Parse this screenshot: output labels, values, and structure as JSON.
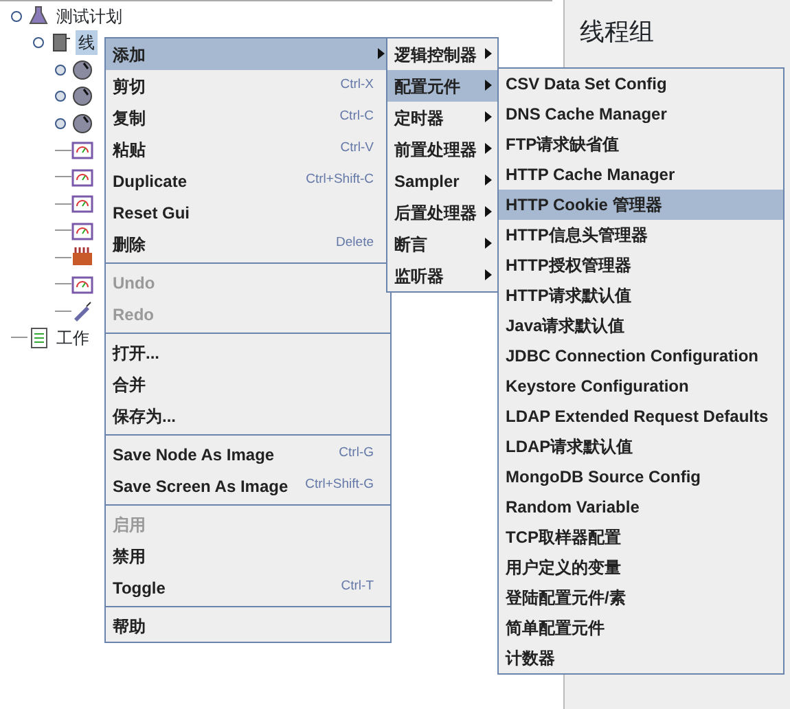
{
  "tree": {
    "label": "测试计划",
    "expanded": true,
    "children": [
      {
        "label": "线",
        "kind": "thread",
        "selected": true,
        "expanded": true,
        "children": [
          {
            "kind": "controller",
            "expanded": false
          },
          {
            "kind": "controller",
            "expanded": false
          },
          {
            "kind": "controller",
            "expanded": false
          },
          {
            "kind": "listener"
          },
          {
            "kind": "listener"
          },
          {
            "kind": "listener"
          },
          {
            "kind": "listener"
          },
          {
            "kind": "timer"
          },
          {
            "kind": "listener"
          },
          {
            "kind": "sampler"
          }
        ]
      }
    ],
    "after": {
      "label": "工作",
      "kind": "workbench"
    }
  },
  "panel": {
    "title": "线程组"
  },
  "context_menu": [
    {
      "kind": "item",
      "label": "添加",
      "selected": true,
      "submenu": true,
      "disabled": false
    },
    {
      "kind": "item",
      "label": "剪切",
      "shortcut": "Ctrl-X",
      "selected": false,
      "disabled": false
    },
    {
      "kind": "item",
      "label": "复制",
      "shortcut": "Ctrl-C",
      "selected": false,
      "disabled": false
    },
    {
      "kind": "item",
      "label": "粘贴",
      "shortcut": "Ctrl-V",
      "selected": false,
      "disabled": false
    },
    {
      "kind": "item",
      "label": "Duplicate",
      "shortcut": "Ctrl+Shift-C",
      "selected": false,
      "disabled": false
    },
    {
      "kind": "item",
      "label": "Reset Gui",
      "selected": false,
      "disabled": false
    },
    {
      "kind": "item",
      "label": "删除",
      "shortcut": "Delete",
      "selected": false,
      "disabled": false
    },
    {
      "kind": "separator"
    },
    {
      "kind": "item",
      "label": "Undo",
      "selected": false,
      "disabled": true
    },
    {
      "kind": "item",
      "label": "Redo",
      "selected": false,
      "disabled": true
    },
    {
      "kind": "separator"
    },
    {
      "kind": "item",
      "label": "打开...",
      "selected": false,
      "disabled": false
    },
    {
      "kind": "item",
      "label": "合并",
      "selected": false,
      "disabled": false
    },
    {
      "kind": "item",
      "label": "保存为...",
      "selected": false,
      "disabled": false
    },
    {
      "kind": "separator"
    },
    {
      "kind": "item",
      "label": "Save Node As Image",
      "shortcut": "Ctrl-G",
      "selected": false,
      "disabled": false
    },
    {
      "kind": "item",
      "label": "Save Screen As Image",
      "shortcut": "Ctrl+Shift-G",
      "selected": false,
      "disabled": false
    },
    {
      "kind": "separator"
    },
    {
      "kind": "item",
      "label": "启用",
      "selected": false,
      "disabled": true
    },
    {
      "kind": "item",
      "label": "禁用",
      "selected": false,
      "disabled": false
    },
    {
      "kind": "item",
      "label": "Toggle",
      "shortcut": "Ctrl-T",
      "selected": false,
      "disabled": false
    },
    {
      "kind": "separator"
    },
    {
      "kind": "item",
      "label": "帮助",
      "selected": false,
      "disabled": false
    }
  ],
  "add_submenu": [
    {
      "label": "逻辑控制器",
      "selected": false,
      "submenu": true
    },
    {
      "label": "配置元件",
      "selected": true,
      "submenu": true
    },
    {
      "label": "定时器",
      "selected": false,
      "submenu": true
    },
    {
      "label": "前置处理器",
      "selected": false,
      "submenu": true
    },
    {
      "label": "Sampler",
      "selected": false,
      "submenu": true
    },
    {
      "label": "后置处理器",
      "selected": false,
      "submenu": true
    },
    {
      "label": "断言",
      "selected": false,
      "submenu": true
    },
    {
      "label": "监听器",
      "selected": false,
      "submenu": true
    }
  ],
  "config_submenu": [
    {
      "label": "CSV Data Set Config",
      "selected": false
    },
    {
      "label": "DNS Cache Manager",
      "selected": false
    },
    {
      "label": "FTP请求缺省值",
      "selected": false
    },
    {
      "label": "HTTP Cache Manager",
      "selected": false
    },
    {
      "label": "HTTP Cookie 管理器",
      "selected": true
    },
    {
      "label": "HTTP信息头管理器",
      "selected": false
    },
    {
      "label": "HTTP授权管理器",
      "selected": false
    },
    {
      "label": "HTTP请求默认值",
      "selected": false
    },
    {
      "label": "Java请求默认值",
      "selected": false
    },
    {
      "label": "JDBC Connection Configuration",
      "selected": false
    },
    {
      "label": "Keystore Configuration",
      "selected": false
    },
    {
      "label": "LDAP Extended Request Defaults",
      "selected": false
    },
    {
      "label": "LDAP请求默认值",
      "selected": false
    },
    {
      "label": "MongoDB Source Config",
      "selected": false
    },
    {
      "label": "Random Variable",
      "selected": false
    },
    {
      "label": "TCP取样器配置",
      "selected": false
    },
    {
      "label": "用户定义的变量",
      "selected": false
    },
    {
      "label": "登陆配置元件/素",
      "selected": false
    },
    {
      "label": "简单配置元件",
      "selected": false
    },
    {
      "label": "计数器",
      "selected": false
    }
  ]
}
